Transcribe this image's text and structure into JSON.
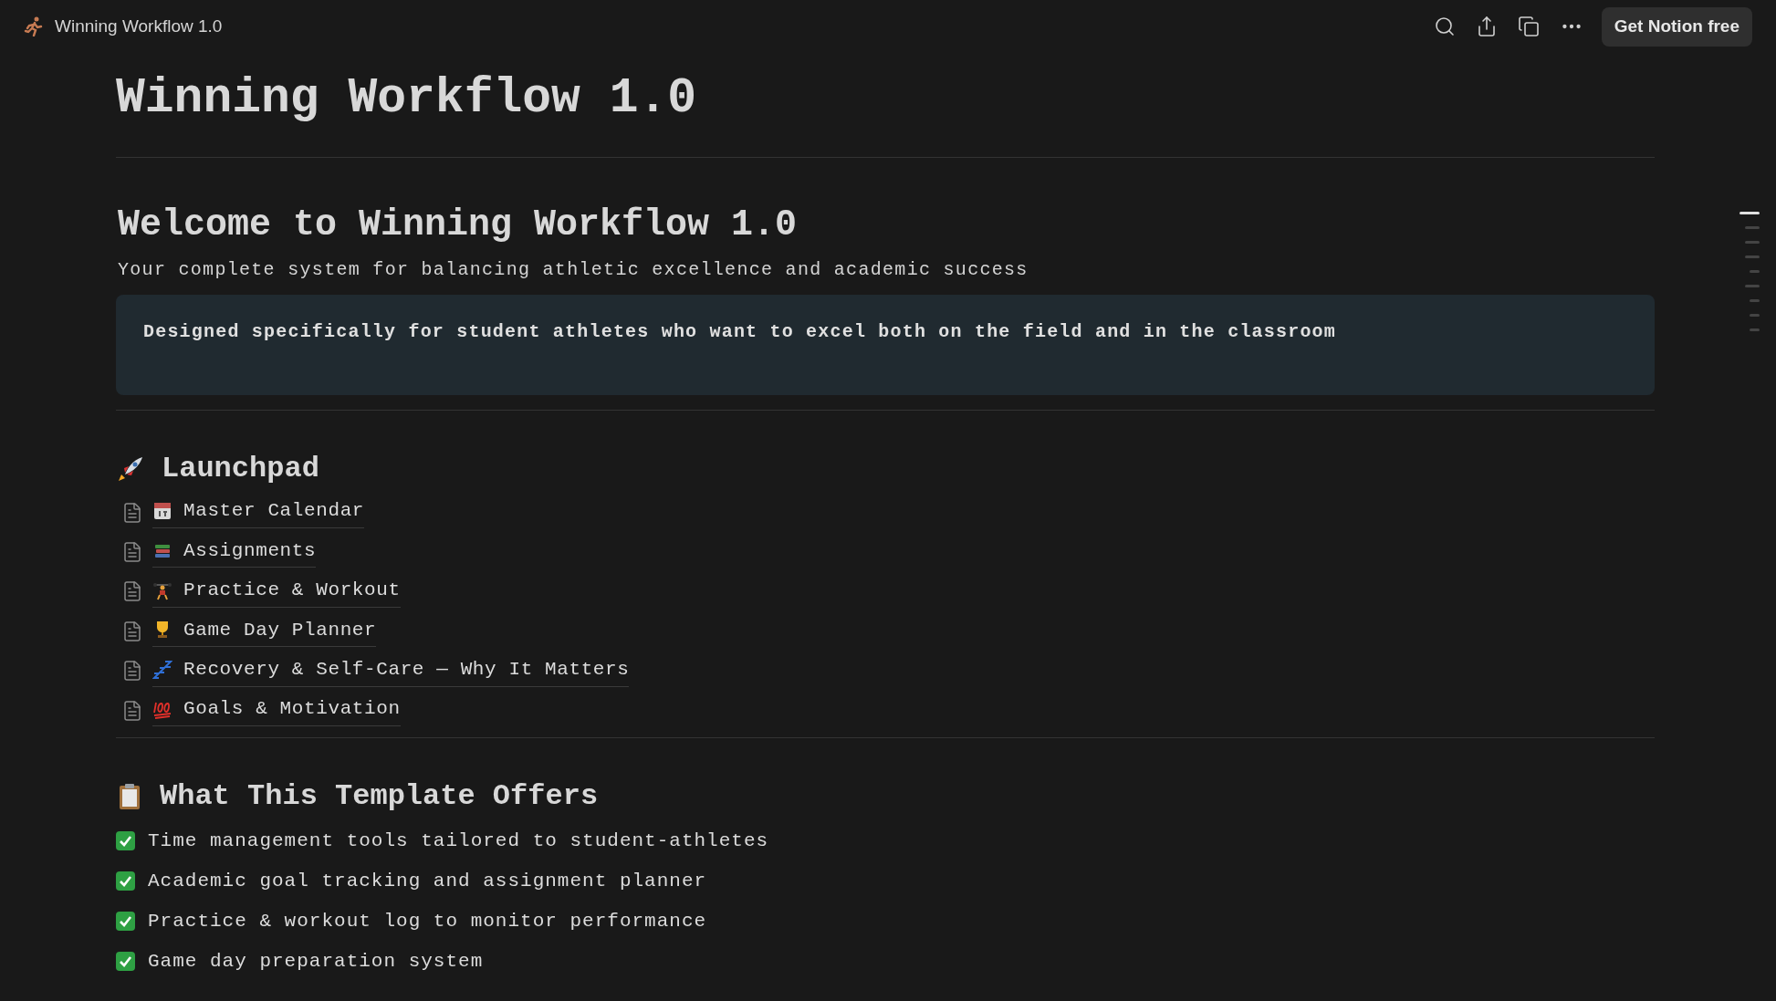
{
  "topbar": {
    "title": "Winning Workflow 1.0",
    "cta": "Get Notion free"
  },
  "page_title": "Winning Workflow 1.0",
  "welcome": {
    "heading": "Welcome to Winning Workflow 1.0",
    "subtitle": "Your complete system for balancing athletic excellence and academic success",
    "callout": "Designed specifically for student athletes who want to excel both on the field and in the classroom"
  },
  "launchpad": {
    "heading": "Launchpad",
    "pages": [
      {
        "label": "Master Calendar"
      },
      {
        "label": "Assignments"
      },
      {
        "label": "Practice & Workout"
      },
      {
        "label": "Game Day Planner"
      },
      {
        "label": "Recovery & Self-Care — Why It Matters"
      },
      {
        "label": "Goals & Motivation"
      }
    ]
  },
  "offers": {
    "heading": "What This Template Offers",
    "items": [
      {
        "checked": true,
        "text": "Time management tools tailored to student-athletes"
      },
      {
        "checked": true,
        "text": "Academic goal tracking and assignment planner"
      },
      {
        "checked": true,
        "text": "Practice & workout log to monitor performance"
      },
      {
        "checked": true,
        "text": "Game day preparation system"
      }
    ]
  },
  "outline": [
    {
      "kind": "h2",
      "selected": true
    },
    {
      "kind": "h2",
      "selected": false
    },
    {
      "kind": "h2",
      "selected": false
    },
    {
      "kind": "h2",
      "selected": false
    },
    {
      "kind": "h3",
      "selected": false
    },
    {
      "kind": "h2",
      "selected": false
    },
    {
      "kind": "h3",
      "selected": false
    },
    {
      "kind": "h3",
      "selected": false
    },
    {
      "kind": "h3",
      "selected": false
    }
  ]
}
